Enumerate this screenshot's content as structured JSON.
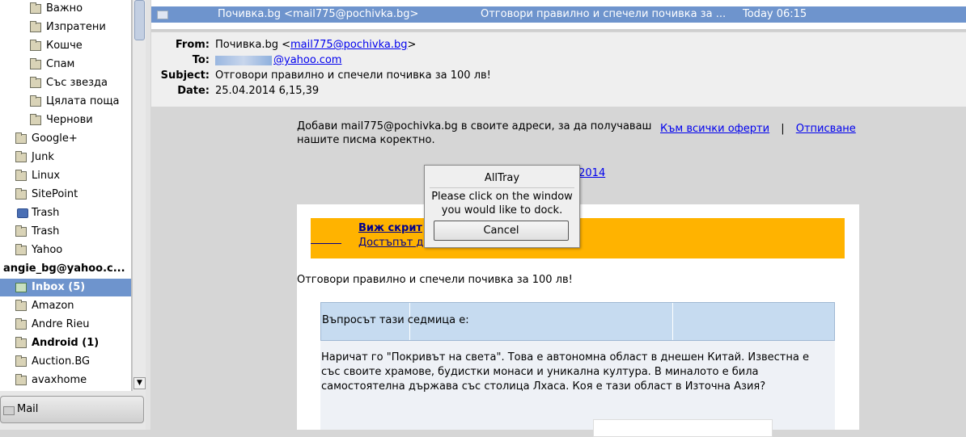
{
  "sidebar": {
    "items": [
      {
        "label": "Важно"
      },
      {
        "label": "Изпратени"
      },
      {
        "label": "Кошче"
      },
      {
        "label": "Спам"
      },
      {
        "label": "Със звезда"
      },
      {
        "label": "Цялата поща"
      },
      {
        "label": "Чернови"
      },
      {
        "label": "Google+"
      },
      {
        "label": "Junk"
      },
      {
        "label": "Linux"
      },
      {
        "label": "SitePoint"
      },
      {
        "label": "Trash"
      },
      {
        "label": "Trash"
      },
      {
        "label": "Yahoo"
      },
      {
        "label": "angie_bg@yahoo.c..."
      },
      {
        "label": "Inbox",
        "count": "(5)"
      },
      {
        "label": "Amazon"
      },
      {
        "label": "Andre Rieu"
      },
      {
        "label": "Android",
        "count": "(1)"
      },
      {
        "label": "Auction.BG"
      },
      {
        "label": "avaxhome"
      }
    ],
    "mail_button": "Mail"
  },
  "message_list": {
    "sender": "Почивка.bg  <mail775@pochivka.bg>",
    "subject": "Отговори правилно и спечели почивка за ...",
    "date": "Today 06:15"
  },
  "header": {
    "from_label": "From:",
    "from_name": "Почивка.bg <",
    "from_email": "mail775@pochivka.bg",
    "from_close": ">",
    "to_label": "To:",
    "to_email": "@yahoo.com",
    "subject_label": "Subject:",
    "subject": "Отговори правилно и спечели почивка за 100 лв!",
    "date_label": "Date:",
    "date": "25.04.2014 6,15,39"
  },
  "body": {
    "notice": "Добави mail775@pochivka.bg в своите адреси, за да получаваш нашите писма коректно.",
    "all_offers": "Към всички оферти",
    "separator": "|",
    "unsubscribe": "Отписване",
    "date_link": ".2014",
    "banner_title": "Виж скрит",
    "banner_text": "Достъпът д                          абонатите на Почивка.bg ",
    "subject_line": "Отговори правилно и спечели почивка за 100 лв!",
    "question_header": "Въпросът тази седмица е:",
    "question_text": "Наричат го \"Покривът на света\". Това е автономна област в днешен Китай. Известна е със своите храмове, будистки монаси и уникална култура. В миналото е била самостоятелна държава със столица Лхаса. Коя е тази област в Източна Азия?"
  },
  "dialog": {
    "title": "AllTray",
    "message": "Please click on the window you would like to dock.",
    "cancel": "Cancel"
  }
}
